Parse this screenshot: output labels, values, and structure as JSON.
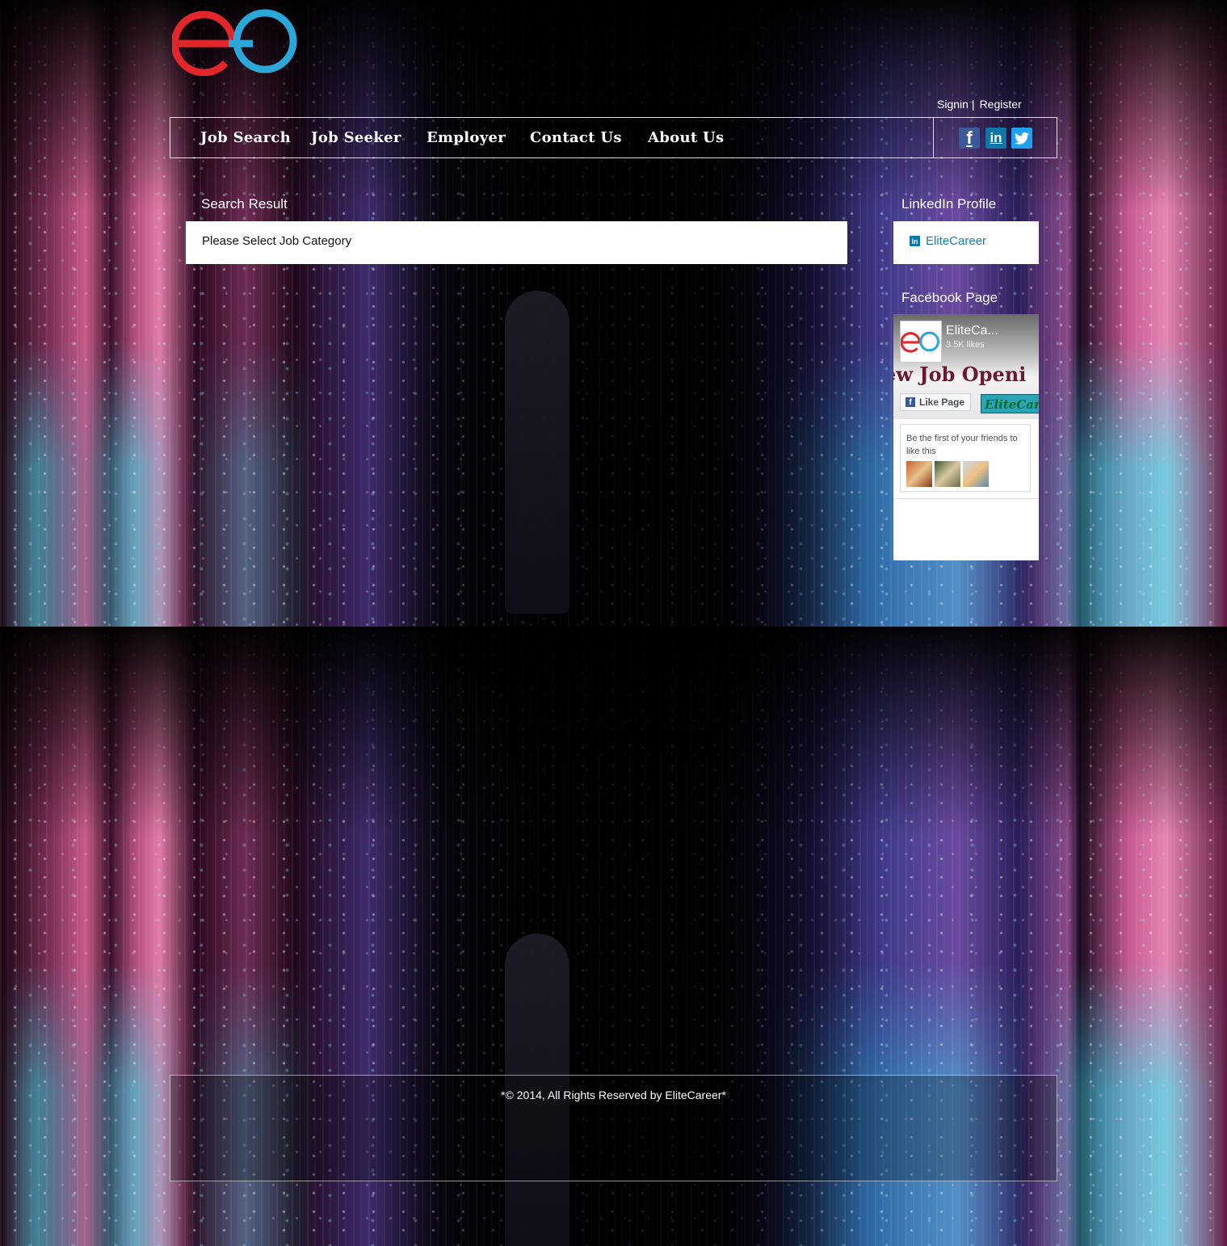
{
  "header": {
    "auth": {
      "signin": "Signin",
      "separator": "|",
      "register": "Register"
    }
  },
  "nav": {
    "items": [
      "Job Search",
      "Job Seeker",
      "Employer",
      "Contact Us",
      "About Us"
    ],
    "social": [
      "facebook-icon",
      "linkedin-icon",
      "twitter-icon"
    ]
  },
  "main": {
    "search_result_title": "Search Result",
    "result_message": "Please Select Job Category"
  },
  "sidebar": {
    "linkedin_title": "LinkedIn Profile",
    "linkedin_link": "EliteCareer",
    "facebook_title": "Facebook Page",
    "facebook_widget": {
      "page_name": "EliteCa...",
      "likes": "3.5K likes",
      "cover_text": "ew Job Openi",
      "like_button": "Like Page",
      "cover_tag": "EliteCar",
      "friends_text": "Be the first of your friends to like this"
    }
  },
  "footer": {
    "copyright": "*© 2014, All Rights Reserved by EliteCareer*"
  },
  "colors": {
    "logo_red": "#e3262c",
    "logo_blue": "#2aa8d8",
    "link_blue": "#1a7fb0",
    "facebook": "#3b5998",
    "linkedin": "#0e76a8",
    "twitter": "#1da1f2"
  }
}
